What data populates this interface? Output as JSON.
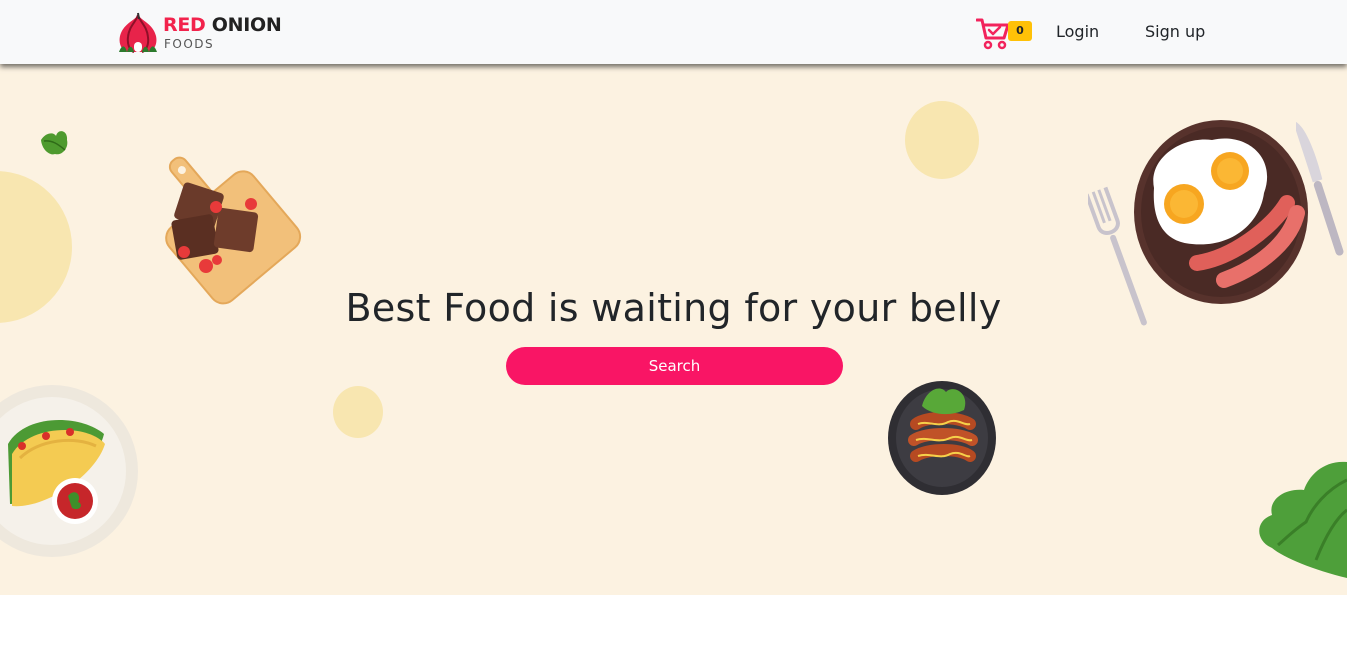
{
  "brand": {
    "word_red": "RED",
    "word_dark": " ONION",
    "sub": "FOODS",
    "colors": {
      "red": "#f2234c",
      "dark": "#222222"
    }
  },
  "nav": {
    "cart_icon": "shopping-cart-icon",
    "cart_count": "0",
    "login": "Login",
    "signup": "Sign up"
  },
  "hero": {
    "title": "Best Food is waiting for your belly",
    "search_button": "Search",
    "background": "#fcf2e1",
    "accent": "#f91565"
  }
}
